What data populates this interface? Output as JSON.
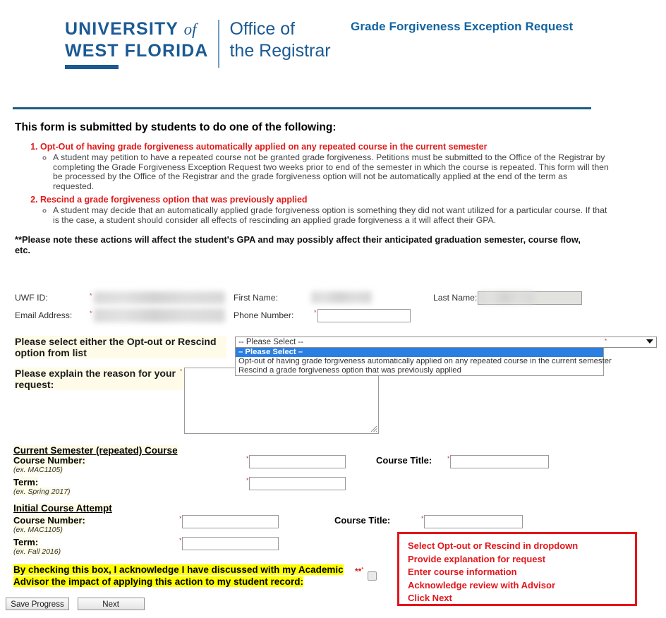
{
  "header": {
    "logo_line1_a": "UNIVERSITY",
    "logo_line1_of": "of",
    "logo_line2": "WEST FLORIDA",
    "logo_right_line1": "Office of",
    "logo_right_line2": "the Registrar",
    "form_title": "Grade Forgiveness Exception Request",
    "accent_color": "#1b5a94",
    "title_color": "#1364a0",
    "divider_color": "#1a5f83"
  },
  "intro": {
    "heading": "This form is submitted by students to do one of the following:",
    "reasons": [
      {
        "title": "Opt-Out of having grade forgiveness automatically applied on any repeated course in the current semester",
        "detail": "A student may petition to have a repeated course not be granted grade forgiveness. Petitions must be submitted to the Office of the Registrar by completing the Grade Forgiveness Exception Request two weeks prior to end of the semester in which the course is repeated. This form will then be processed by the Office of the Registrar and the grade forgiveness option will not be automatically applied at the end of the term as requested."
      },
      {
        "title": "Rescind a grade forgiveness option that was previously applied",
        "detail": "A student may decide that an automatically applied grade forgiveness option is something they did not want utilized for a particular course. If that is the case, a student should consider all effects of rescinding an applied grade forgiveness a it will affect their GPA."
      }
    ],
    "note": "**Please note these actions will affect the student's GPA and may possibly affect their anticipated graduation semester, course flow, etc.",
    "reason_color": "#e01b1b"
  },
  "identity": {
    "uwf_id_label": "UWF ID:",
    "uwf_id_value": "",
    "email_label": "Email Address:",
    "email_value": "",
    "first_name_label": "First Name:",
    "first_name_value": "",
    "last_name_label": "Last Name:",
    "last_name_value": "",
    "phone_label": "Phone Number:",
    "phone_value": ""
  },
  "selection": {
    "label": "Please select either the Opt-out or Rescind option from list",
    "selected_value": "-- Please Select --",
    "options": [
      "– Please Select –",
      "Opt-out of having grade forgiveness automatically applied on any repeated course in the current semester",
      "Rescind a grade forgiveness option that was previously applied"
    ],
    "highlight_index": 0,
    "highlight_color": "#2b7fe0"
  },
  "reason": {
    "label": "Please explain the reason for your request:",
    "value": ""
  },
  "current_course": {
    "heading": "Current Semester (repeated) Course",
    "course_number_label": "Course Number:",
    "course_number_hint": "(ex. MAC1105)",
    "course_number_value": "",
    "term_label": "Term:",
    "term_hint": "(ex. Spring 2017)",
    "term_value": "",
    "course_title_label": "Course Title:",
    "course_title_value": ""
  },
  "initial_course": {
    "heading": "Initial Course Attempt",
    "course_number_label": "Course Number:",
    "course_number_hint": "(ex. MAC1105)",
    "course_number_value": "",
    "term_label": "Term:",
    "term_hint": "(ex. Fall 2016)",
    "term_value": "",
    "course_title_label": "Course Title:",
    "course_title_value": ""
  },
  "annotation": {
    "border_color": "#e3161b",
    "lines": [
      "Select Opt-out or Rescind in dropdown",
      "Provide explanation for request",
      "Enter course information",
      "Acknowledge review with Advisor",
      "Click Next"
    ]
  },
  "acknowledge": {
    "text": "By checking this box, I acknowledge I have discussed with my Academic Advisor the impact of applying this action to my student record:",
    "stars": "**",
    "checked": false,
    "highlight_color": "#ffff00"
  },
  "buttons": {
    "save_label": "Save Progress",
    "next_label": "Next"
  }
}
